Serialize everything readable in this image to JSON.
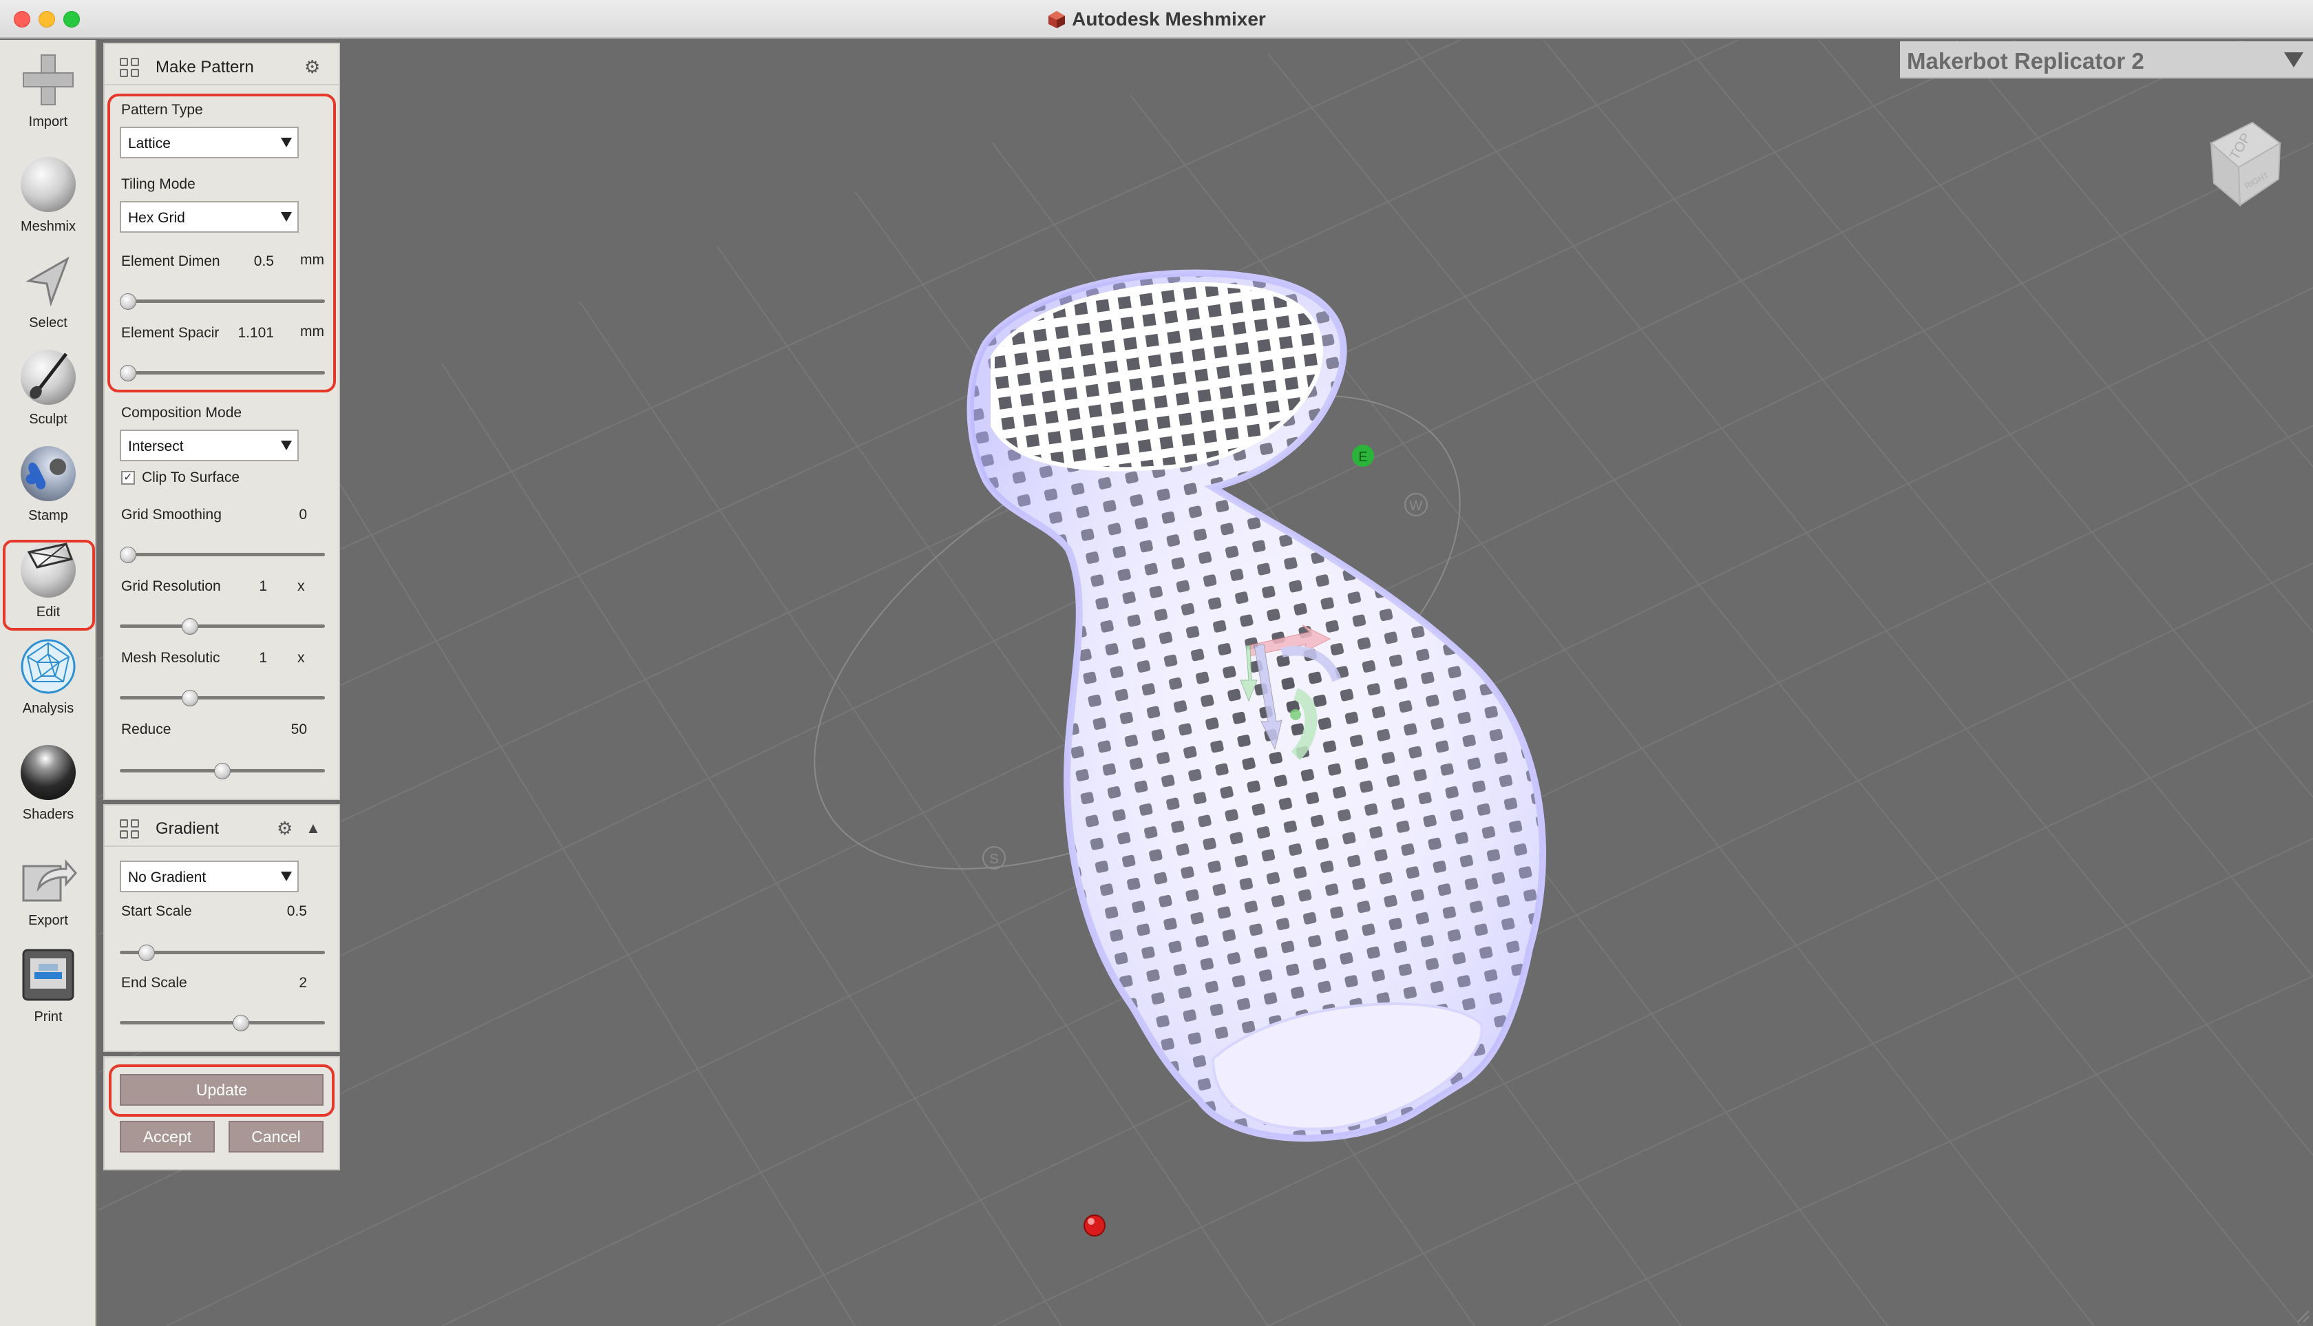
{
  "window": {
    "title": "Autodesk Meshmixer"
  },
  "toolbar": {
    "items": [
      {
        "label": "Import"
      },
      {
        "label": "Meshmix"
      },
      {
        "label": "Select"
      },
      {
        "label": "Sculpt"
      },
      {
        "label": "Stamp"
      },
      {
        "label": "Edit"
      },
      {
        "label": "Analysis"
      },
      {
        "label": "Shaders"
      },
      {
        "label": "Export"
      },
      {
        "label": "Print"
      }
    ]
  },
  "make_pattern": {
    "title": "Make Pattern",
    "pattern_type_label": "Pattern Type",
    "pattern_type_value": "Lattice",
    "tiling_mode_label": "Tiling Mode",
    "tiling_mode_value": "Hex Grid",
    "element_dimension_label": "Element Dimen",
    "element_dimension_value": "0.5",
    "element_dimension_unit": "mm",
    "element_dimension_slider": 0.0,
    "element_spacing_label": "Element Spacir",
    "element_spacing_value": "1.101",
    "element_spacing_unit": "mm",
    "element_spacing_slider": 0.0,
    "composition_mode_label": "Composition Mode",
    "composition_mode_value": "Intersect",
    "clip_to_surface_label": "Clip To Surface",
    "clip_to_surface_checked": true,
    "clip_to_surface_mark": "✓",
    "grid_smoothing_label": "Grid Smoothing",
    "grid_smoothing_value": "0",
    "grid_smoothing_slider": 0.0,
    "grid_resolution_label": "Grid Resolution",
    "grid_resolution_value": "1",
    "grid_resolution_unit": "x",
    "grid_resolution_slider": 0.33,
    "mesh_resolution_label": "Mesh Resolutic",
    "mesh_resolution_value": "1",
    "mesh_resolution_unit": "x",
    "mesh_resolution_slider": 0.33,
    "reduce_label": "Reduce",
    "reduce_value": "50",
    "reduce_slider": 0.5
  },
  "gradient": {
    "title": "Gradient",
    "mode_value": "No Gradient",
    "start_scale_label": "Start Scale",
    "start_scale_value": "0.5",
    "start_scale_slider": 0.1,
    "end_scale_label": "End Scale",
    "end_scale_value": "2",
    "end_scale_slider": 0.6
  },
  "actions": {
    "update_label": "Update",
    "accept_label": "Accept",
    "cancel_label": "Cancel"
  },
  "viewport": {
    "printer_name": "Makerbot Replicator 2",
    "view_cube_top": "TOP",
    "view_cube_right": "RIGHT",
    "compass_w": "W",
    "compass_s": "S",
    "compass_e": "E"
  },
  "colors": {
    "highlight": "#e53a2b",
    "viewport_bg": "#6b6b6b",
    "panel_bg": "#e7e5e0",
    "button": "#a89795",
    "mesh": "#f2f0ff"
  }
}
